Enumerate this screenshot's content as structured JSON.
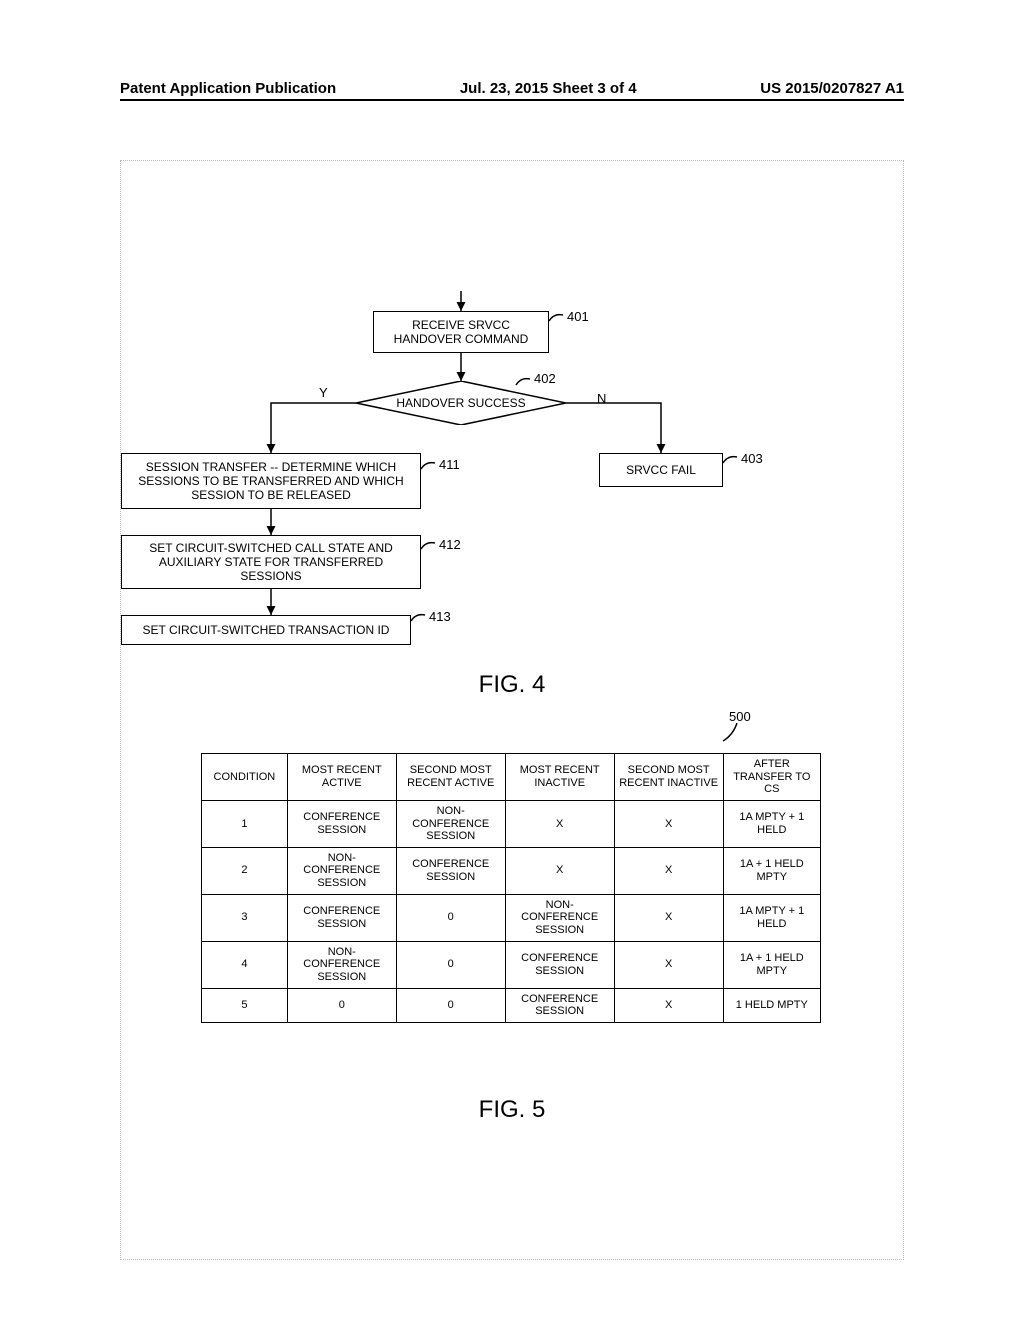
{
  "header": {
    "left": "Patent Application Publication",
    "center": "Jul. 23, 2015  Sheet 3 of 4",
    "right": "US 2015/0207827 A1"
  },
  "flow": {
    "b401": "RECEIVE SRVCC HANDOVER COMMAND",
    "b402": "HANDOVER SUCCESS",
    "b403": "SRVCC FAIL",
    "b411": "SESSION TRANSFER -- DETERMINE WHICH SESSIONS TO BE TRANSFERRED AND WHICH SESSION TO BE RELEASED",
    "b412": "SET CIRCUIT-SWITCHED CALL STATE AND AUXILIARY STATE FOR TRANSFERRED SESSIONS",
    "b413": "SET CIRCUIT-SWITCHED TRANSACTION ID",
    "r401": "401",
    "r402": "402",
    "r403": "403",
    "r411": "411",
    "r412": "412",
    "r413": "413",
    "y": "Y",
    "n": "N",
    "fig4": "FIG. 4",
    "fig5": "FIG. 5",
    "ref500": "500"
  },
  "chart_data": {
    "type": "table",
    "columns": [
      "CONDITION",
      "MOST RECENT ACTIVE",
      "SECOND MOST RECENT ACTIVE",
      "MOST RECENT INACTIVE",
      "SECOND MOST RECENT INACTIVE",
      "AFTER TRANSFER TO CS"
    ],
    "rows": [
      [
        "1",
        "CONFERENCE SESSION",
        "NON-CONFERENCE SESSION",
        "X",
        "X",
        "1A MPTY + 1 HELD"
      ],
      [
        "2",
        "NON-CONFERENCE SESSION",
        "CONFERENCE SESSION",
        "X",
        "X",
        "1A + 1 HELD MPTY"
      ],
      [
        "3",
        "CONFERENCE SESSION",
        "0",
        "NON-CONFERENCE SESSION",
        "X",
        "1A MPTY + 1 HELD"
      ],
      [
        "4",
        "NON-CONFERENCE SESSION",
        "0",
        "CONFERENCE SESSION",
        "X",
        "1A + 1 HELD MPTY"
      ],
      [
        "5",
        "0",
        "0",
        "CONFERENCE SESSION",
        "X",
        "1 HELD MPTY"
      ]
    ]
  }
}
